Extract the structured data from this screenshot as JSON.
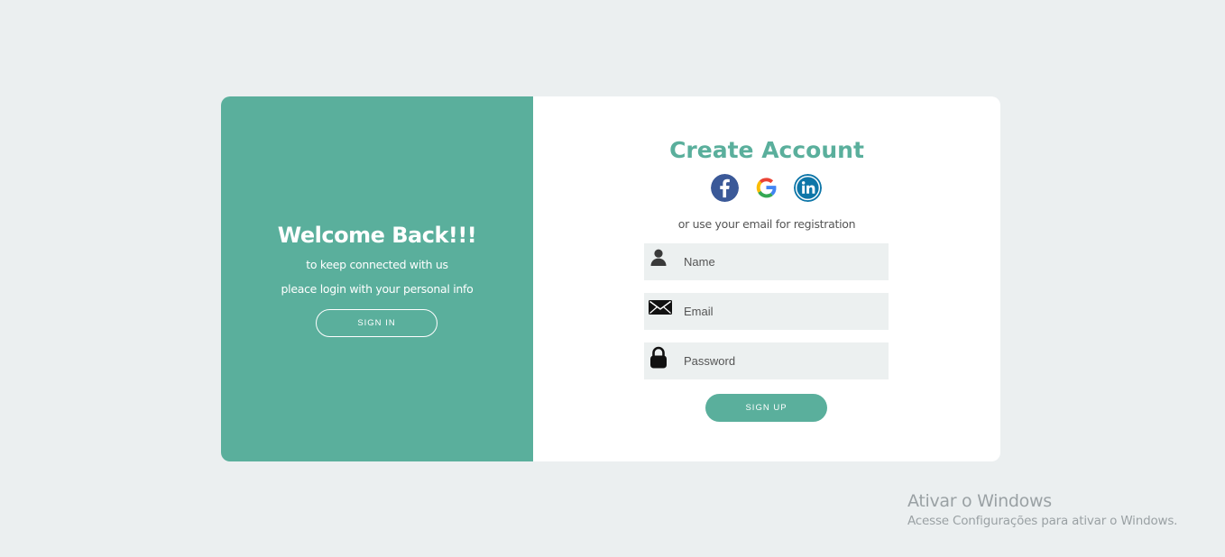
{
  "left_panel": {
    "title": "Welcome Back!!!",
    "line1": "to keep connected with us",
    "line2": "pleace login with your personal info",
    "button": "SIGN IN",
    "background": "#5aaf9c"
  },
  "right_panel": {
    "title": "Create Account",
    "social": [
      {
        "icon": "facebook-icon"
      },
      {
        "icon": "google-icon"
      },
      {
        "icon": "linkedin-icon"
      }
    ],
    "alt_text": "or use your email for registration",
    "fields": [
      {
        "icon": "user-icon",
        "placeholder": "Name",
        "value": ""
      },
      {
        "icon": "envelope-icon",
        "placeholder": "Email",
        "value": ""
      },
      {
        "icon": "lock-icon",
        "placeholder": "Password",
        "value": ""
      }
    ],
    "button": "SIGN UP",
    "accent": "#5aaf9c"
  },
  "watermark": {
    "title": "Ativar o Windows",
    "subtitle": "Acesse Configurações para ativar o Windows."
  }
}
